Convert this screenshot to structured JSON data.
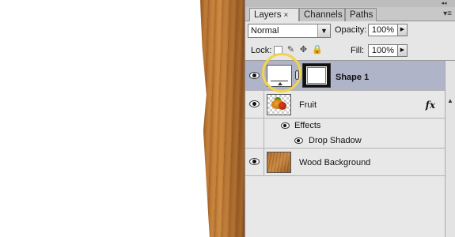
{
  "panel": {
    "tabs": [
      {
        "label": "Layers",
        "close": "×"
      },
      {
        "label": "Channels",
        "close": "×"
      },
      {
        "label": "Paths"
      }
    ],
    "collapse_glyph": "◂◂",
    "menu_glyph": "▾≡",
    "blend_mode": "Normal",
    "opacity_label": "Opacity:",
    "opacity_value": "100%",
    "lock_label": "Lock:",
    "fill_label": "Fill:",
    "fill_value": "100%"
  },
  "layers": [
    {
      "name": "Shape 1",
      "selected": true,
      "visible": true,
      "has_vector_mask": true,
      "highlighted": true
    },
    {
      "name": "Fruit",
      "visible": true,
      "fx_label": "fx",
      "effects": {
        "label": "Effects",
        "items": [
          {
            "name": "Drop Shadow"
          }
        ]
      }
    },
    {
      "name": "Wood Background",
      "visible": true
    }
  ],
  "colors": {
    "selected_row": "#b0b4c8",
    "highlight_ring": "#f3d34a",
    "wood": "#b87532",
    "panel_bg": "#e8e8e8"
  }
}
